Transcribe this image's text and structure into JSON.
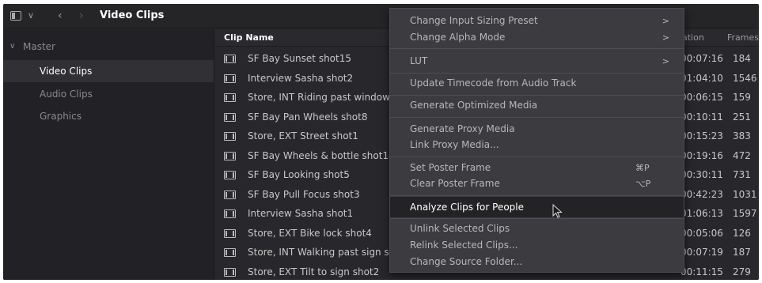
{
  "header": {
    "title": "Video Clips",
    "chevron": "∨",
    "back": "‹",
    "forward": "›"
  },
  "sidebar": {
    "root": {
      "chevron": "∨",
      "label": "Master"
    },
    "items": [
      {
        "label": "Video Clips",
        "selected": true
      },
      {
        "label": "Audio Clips",
        "selected": false
      },
      {
        "label": "Graphics",
        "selected": false
      }
    ]
  },
  "list": {
    "columns": {
      "clip_name": "Clip Name",
      "duration": "ation",
      "frames": "Frames"
    },
    "rows": [
      {
        "name": "SF Bay Sunset shot15",
        "duration": "00:07:16",
        "frames": "184"
      },
      {
        "name": "Interview Sasha shot2",
        "duration": "01:04:10",
        "frames": "1546"
      },
      {
        "name": "Store, INT Riding past window",
        "duration": "00:06:15",
        "frames": "159"
      },
      {
        "name": "SF Bay Pan Wheels shot8",
        "duration": "00:10:11",
        "frames": "251"
      },
      {
        "name": "Store, EXT Street shot1",
        "duration": "00:15:23",
        "frames": "383"
      },
      {
        "name": "SF Bay Wheels & bottle shot14",
        "duration": "00:19:16",
        "frames": "472"
      },
      {
        "name": "SF Bay Looking shot5",
        "duration": "00:30:11",
        "frames": "731"
      },
      {
        "name": "SF Bay Pull Focus shot3",
        "duration": "00:42:23",
        "frames": "1031"
      },
      {
        "name": "Interview Sasha shot1",
        "duration": "01:06:13",
        "frames": "1597"
      },
      {
        "name": "Store, EXT Bike lock shot4",
        "duration": "00:05:06",
        "frames": "126"
      },
      {
        "name": "Store, INT Walking past sign sl",
        "duration": "00:07:19",
        "frames": "187"
      },
      {
        "name": "Store, EXT Tilt to sign shot2",
        "duration": "00:11:15",
        "frames": "279"
      }
    ]
  },
  "context_menu": {
    "items": [
      {
        "label": "Change Input Sizing Preset",
        "arrow": ">"
      },
      {
        "label": "Change Alpha Mode",
        "arrow": ">"
      },
      {
        "label": "LUT",
        "arrow": ">"
      },
      {
        "label": "Update Timecode from Audio Track"
      },
      {
        "label": "Generate Optimized Media"
      },
      {
        "label": "Generate Proxy Media"
      },
      {
        "label": "Link Proxy Media..."
      },
      {
        "label": "Set Poster Frame",
        "shortcut": "⌘P"
      },
      {
        "label": "Clear Poster Frame",
        "shortcut": "⌥P"
      },
      {
        "label": "Analyze Clips for People",
        "highlighted": true
      },
      {
        "label": "Unlink Selected Clips"
      },
      {
        "label": "Relink Selected Clips..."
      },
      {
        "label": "Change Source Folder..."
      }
    ]
  },
  "colors": {
    "background": "#28282c",
    "menu": "#3b3b40",
    "highlight": "#232326",
    "text": "#c8c8c8"
  }
}
